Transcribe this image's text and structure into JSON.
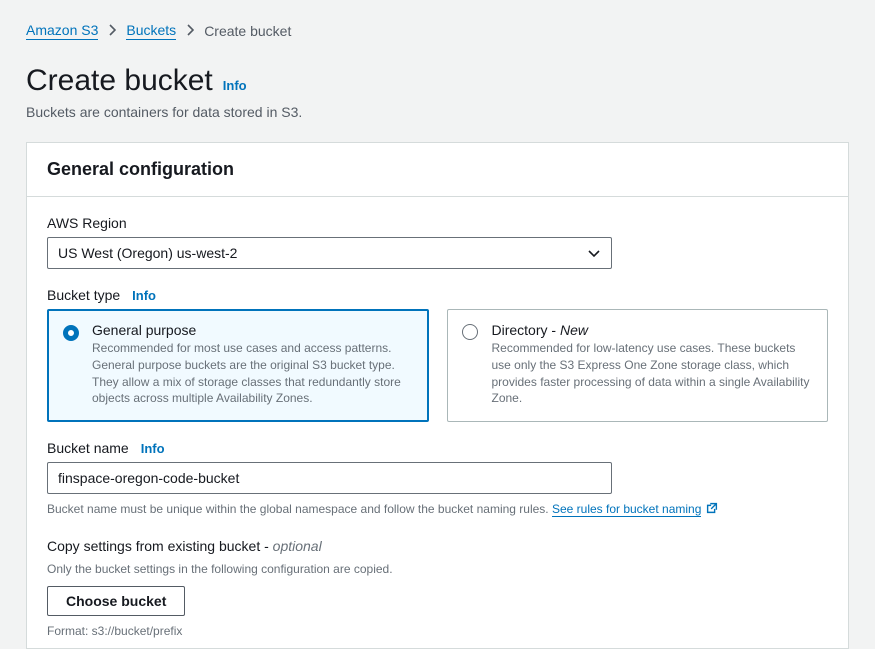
{
  "breadcrumb": {
    "root": "Amazon S3",
    "parent": "Buckets",
    "current": "Create bucket"
  },
  "page": {
    "title": "Create bucket",
    "info": "Info",
    "desc": "Buckets are containers for data stored in S3."
  },
  "section": {
    "title": "General configuration"
  },
  "region": {
    "label": "AWS Region",
    "selected": "US West (Oregon) us-west-2"
  },
  "bucket_type": {
    "label": "Bucket type",
    "info": "Info",
    "general": {
      "title": "General purpose",
      "desc": "Recommended for most use cases and access patterns. General purpose buckets are the original S3 bucket type. They allow a mix of storage classes that redundantly store objects across multiple Availability Zones."
    },
    "directory": {
      "title_prefix": "Directory - ",
      "title_new": "New",
      "desc": "Recommended for low-latency use cases. These buckets use only the S3 Express One Zone storage class, which provides faster processing of data within a single Availability Zone."
    }
  },
  "bucket_name": {
    "label": "Bucket name",
    "info": "Info",
    "value": "finspace-oregon-code-bucket",
    "help_prefix": "Bucket name must be unique within the global namespace and follow the bucket naming rules. ",
    "help_link": "See rules for bucket naming"
  },
  "copy_settings": {
    "label_prefix": "Copy settings from existing bucket - ",
    "optional": "optional",
    "desc": "Only the bucket settings in the following configuration are copied.",
    "button": "Choose bucket",
    "format": "Format: s3://bucket/prefix"
  }
}
